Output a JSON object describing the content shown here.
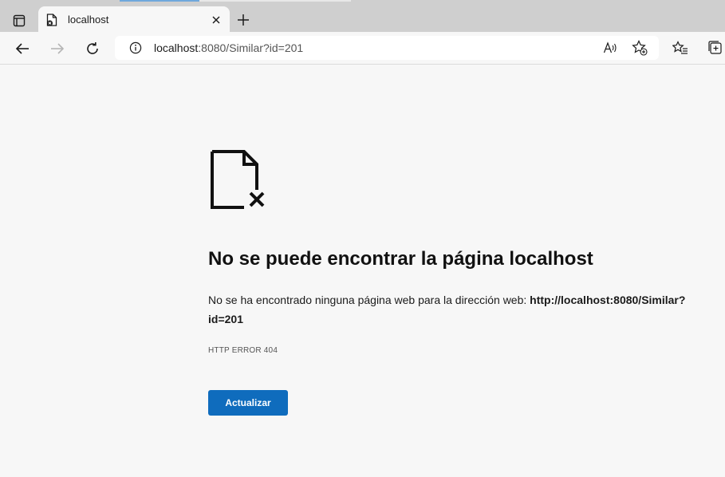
{
  "browser": {
    "tab": {
      "title": "localhost"
    },
    "address_bar": {
      "host": "localhost",
      "path": ":8080/Similar?id=201"
    },
    "icons": {
      "tab_actions": "tab-actions-icon",
      "favicon": "page-error-icon",
      "close": "close-icon",
      "new_tab": "plus-icon",
      "back": "back-arrow-icon",
      "forward": "forward-arrow-icon",
      "refresh": "refresh-icon",
      "info": "info-icon",
      "read_aloud": "read-aloud-icon",
      "add_favorite": "star-add-icon",
      "favorites": "favorites-icon",
      "collections": "collections-icon"
    }
  },
  "error_page": {
    "title": "No se puede encontrar la página localhost",
    "description_prefix": "No se ha encontrado ninguna página web para la dirección web: ",
    "url_line1": "http://localhost:8080/Similar?",
    "url_line2": "id=201",
    "error_code": "HTTP ERROR 404",
    "reload_button": "Actualizar"
  },
  "colors": {
    "accent": "#0f6cbd",
    "background": "#f7f7f7"
  }
}
